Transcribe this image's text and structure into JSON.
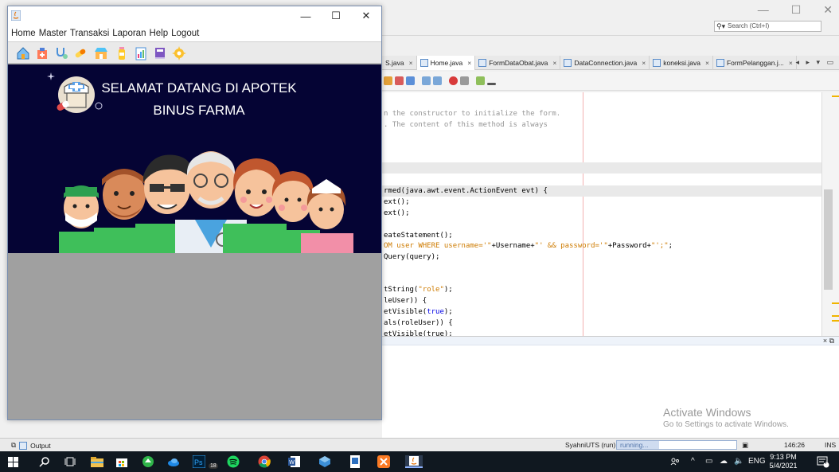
{
  "ide": {
    "search_placeholder": "Search (Ctrl+I)",
    "tabs": [
      {
        "label": "S.java",
        "active": false
      },
      {
        "label": "Home.java",
        "active": true
      },
      {
        "label": "FormDataObat.java",
        "active": false
      },
      {
        "label": "DataConnection.java",
        "active": false
      },
      {
        "label": "koneksi.java",
        "active": false
      },
      {
        "label": "FormPelanggan.j...",
        "active": false
      }
    ],
    "tab_nav": "◂ ▸ ▾ ▭",
    "code": {
      "comment1": "n the constructor to initialize the form.",
      "comment2": ". The content of this method is always",
      "l1a": "rmed(java.awt.event.ActionEvent evt) {",
      "l2": "ext();",
      "l3": "ext();",
      "l4": "eateStatement();",
      "l5_s1": "OM user WHERE username='\"",
      "l5_m1": "+Username+",
      "l5_s2": "\"' && password='\"",
      "l5_m2": "+Password+",
      "l5_s3": "\"';\"",
      "l5_end": ";",
      "l6": "Query(query);",
      "l7a": "tString(",
      "l7s": "\"role\"",
      "l7b": ");",
      "l8": "leUser)) {",
      "l9a": "etVisible(",
      "l9k": "true",
      "l9b": ");",
      "l10": "als(roleUser)) {",
      "l11": "etVisible(true);"
    },
    "output_controls": "× ⧉",
    "activate_title": "Activate Windows",
    "activate_sub": "Go to Settings to activate Windows.",
    "status": {
      "output_label": "Output",
      "project": "SyahniUTS (run)",
      "progress_text": "running...",
      "progress_fraction": 0.35,
      "position": "146:26",
      "mode": "INS"
    }
  },
  "app": {
    "menu": [
      "Home",
      "Master",
      "Transaksi",
      "Laporan",
      "Help",
      "Logout"
    ],
    "window_buttons": {
      "minimize": "—",
      "maximize": "☐",
      "close": "✕"
    },
    "banner_title_line1": "SELAMAT DATANG DI APOTEK",
    "banner_title_line2": "BINUS FARMA"
  },
  "taskbar": {
    "badge": "18",
    "tray_ime": "ENG",
    "time": "9:13 PM",
    "date": "5/4/2021",
    "notif_count": "4"
  },
  "colors": {
    "banner_bg": "#050434",
    "app_body": "#a0a0a0",
    "taskbar": "#101820"
  }
}
